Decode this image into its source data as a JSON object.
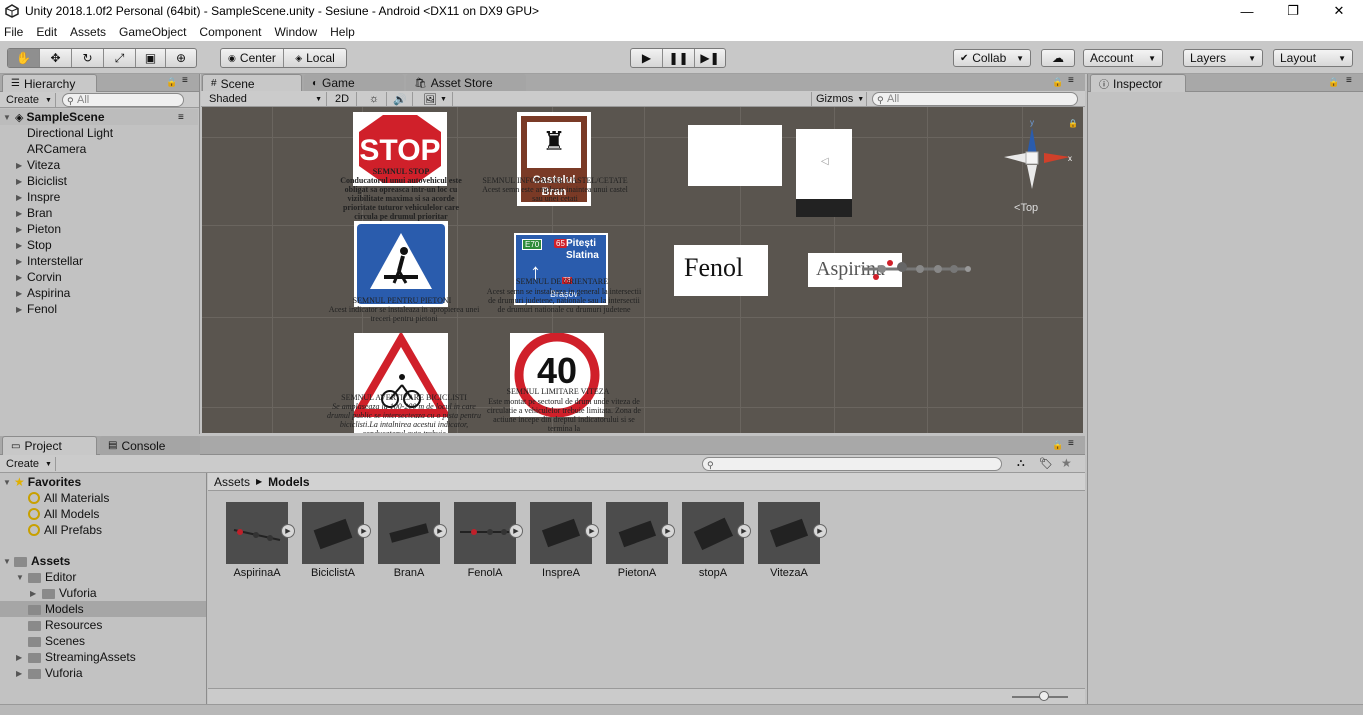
{
  "window": {
    "title": "Unity 2018.1.0f2 Personal (64bit) - SampleScene.unity - Sesiune - Android <DX11 on DX9 GPU>",
    "minimize": "—",
    "maximize": "❐",
    "close": "✕"
  },
  "menu": [
    "File",
    "Edit",
    "Assets",
    "GameObject",
    "Component",
    "Window",
    "Help"
  ],
  "toolbar": {
    "pivot": "Center",
    "space": "Local",
    "collab": "Collab",
    "account": "Account",
    "layers": "Layers",
    "layout": "Layout"
  },
  "hierarchy": {
    "tab": "Hierarchy",
    "create": "Create",
    "search_placeholder": "All",
    "scene": "SampleScene",
    "items": [
      "Directional Light",
      "ARCamera",
      "Viteza",
      "Biciclist",
      "Inspre",
      "Bran",
      "Pieton",
      "Stop",
      "Interstellar",
      "Corvin",
      "Aspirina",
      "Fenol"
    ]
  },
  "scene_tabs": {
    "scene": "Scene",
    "game": "Game",
    "asset_store": "Asset Store"
  },
  "scene_bar": {
    "shading": "Shaded",
    "mode_2d": "2D",
    "gizmos": "Gizmos",
    "search_placeholder": "All"
  },
  "scene_view": {
    "gizmo_label": "Top",
    "gizmo_axes": {
      "y": "y",
      "x": "x"
    },
    "signs": {
      "stop": {
        "glyph": "STOP",
        "title": "SEMNUL STOP",
        "body": "Conducatorul unui autovehicul este obligat sa opreasca intr-un loc cu vizibilitate maxima si sa acorde prioritate tuturor vehiculelor care circula pe drumul prioritar"
      },
      "castel": {
        "glyph": "Castelul Bran",
        "title": "SEMNUL INFORMARE CASTEL/CETATE",
        "body": "Acest semn este amplasat inaintea unui castel sau unei cetati"
      },
      "pieton": {
        "title": "SEMNUL PENTRU PIETONI",
        "body": "Acest indicator se instaleaza in apropierea unei treceri pentru pietoni"
      },
      "orientare": {
        "road1": "E70",
        "road2": "65",
        "city1": "Pitești",
        "city2": "Slatina",
        "road3": "73",
        "city3": "Brașov",
        "title": "SEMNUL DE ORIENTARE",
        "body": "Acest semn se instaleaza in general la intersectii de drumuri judetene, nationale sau la intersectii de drumuri nationale cu drumuri judetene"
      },
      "biciclist": {
        "title": "SEMNUL AVERTIZARE BICICLISTI",
        "body": "Se amplaseaza la 100-200 m de locul in care drumul public se intersecteaza cu o pista pentru biciclisti.La intalnirea acestui indicator, conducatorul auto trebuie"
      },
      "viteza": {
        "glyph": "40",
        "title": "SEMNUL LIMITARE VITEZA",
        "body": "Este montat pe sectorul de drum unde viteza de circulatie a vehiculelor trebuie limitata. Zona de actiune incepe din dreptul indicatorului si se termina la"
      },
      "fenol": "Fenol",
      "aspirina": "Aspirina"
    }
  },
  "inspector": {
    "tab": "Inspector"
  },
  "project": {
    "tab": "Project",
    "console_tab": "Console",
    "create": "Create",
    "breadcrumb_root": "Assets",
    "breadcrumb_current": "Models",
    "favorites_label": "Favorites",
    "favorites": [
      "All Materials",
      "All Models",
      "All Prefabs"
    ],
    "assets_label": "Assets",
    "folders": {
      "editor": "Editor",
      "editor_vuforia": "Vuforia",
      "models": "Models",
      "resources": "Resources",
      "scenes": "Scenes",
      "streaming": "StreamingAssets",
      "vuforia": "Vuforia"
    },
    "assets": [
      "AspirinaA",
      "BiciclistA",
      "BranA",
      "FenolA",
      "InspreA",
      "PietonA",
      "stopA",
      "VitezaA"
    ]
  },
  "colors": {
    "accent_blue": "#2a5cad",
    "stop_red": "#d0202a",
    "scene_bg": "#5a554f"
  }
}
